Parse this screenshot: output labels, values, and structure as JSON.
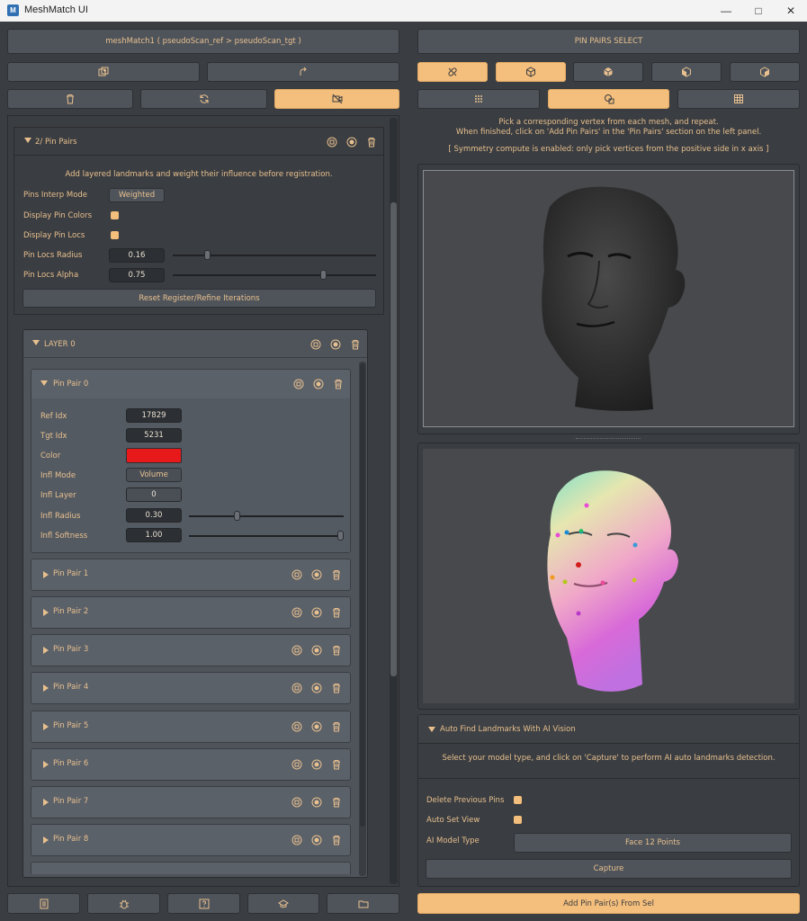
{
  "window": {
    "title": "MeshMatch UI",
    "logo": "M"
  },
  "left": {
    "header_label": "meshMatch1 ( pseudoScan_ref > pseudoScan_tgt )",
    "pin_pairs_section": {
      "title": "2/ Pin Pairs",
      "description": "Add layered landmarks and weight their influence before registration.",
      "labels": {
        "pins_interp_mode": "Pins Interp Mode",
        "display_pin_colors": "Display Pin Colors",
        "display_pin_locs": "Display Pin Locs",
        "pin_locs_radius": "Pin Locs Radius",
        "pin_locs_alpha": "Pin Locs Alpha"
      },
      "values": {
        "pins_interp_mode": "Weighted",
        "pin_locs_radius": "0.16",
        "pin_locs_alpha": "0.75",
        "display_pin_colors": true,
        "display_pin_locs": true
      },
      "sliders": {
        "pin_locs_radius": 0.16,
        "pin_locs_alpha": 0.75
      },
      "reset_button": "Reset Register/Refine Iterations"
    },
    "layer": {
      "title": "LAYER 0",
      "pin_pair_0": {
        "title": "Pin Pair 0",
        "labels": {
          "ref_idx": "Ref Idx",
          "tgt_idx": "Tgt Idx",
          "color": "Color",
          "infl_mode": "Infl Mode",
          "infl_layer": "Infl Layer",
          "infl_radius": "Infl Radius",
          "infl_softness": "Infl Softness"
        },
        "values": {
          "ref_idx": "17829",
          "tgt_idx": "5231",
          "color": "#e8191b",
          "infl_mode": "Volume",
          "infl_layer": "0",
          "infl_radius": "0.30",
          "infl_softness": "1.00"
        },
        "sliders": {
          "infl_radius": 0.3,
          "infl_softness": 1.0
        }
      },
      "collapsed_pairs": [
        "Pin Pair 1",
        "Pin Pair 2",
        "Pin Pair 3",
        "Pin Pair 4",
        "Pin Pair 5",
        "Pin Pair 6",
        "Pin Pair 7",
        "Pin Pair 8"
      ]
    }
  },
  "right": {
    "header_label": "PIN PAIRS SELECT",
    "instructions": {
      "line1": "Pick a corresponding vertex from each mesh, and repeat.",
      "line2": "When finished, click on 'Add Pin Pairs' in the 'Pin Pairs' section on the left panel.",
      "line3": "[ Symmetry compute is enabled: only pick vertices from the positive side in x axis ]"
    },
    "ai_section": {
      "title": "Auto Find Landmarks With AI Vision",
      "description": "Select your model type, and click on 'Capture' to perform AI auto landmarks detection.",
      "labels": {
        "delete_previous_pins": "Delete Previous Pins",
        "auto_set_view": "Auto Set View",
        "ai_model_type": "AI Model Type"
      },
      "values": {
        "ai_model_type": "Face 12 Points",
        "delete_previous_pins": true,
        "auto_set_view": true
      },
      "capture_button": "Capture"
    },
    "add_button": "Add Pin Pair(s) From Sel"
  },
  "colors": {
    "accent": "#f4be7c",
    "text": "#e8c08f",
    "bg": "#3a3d41"
  }
}
